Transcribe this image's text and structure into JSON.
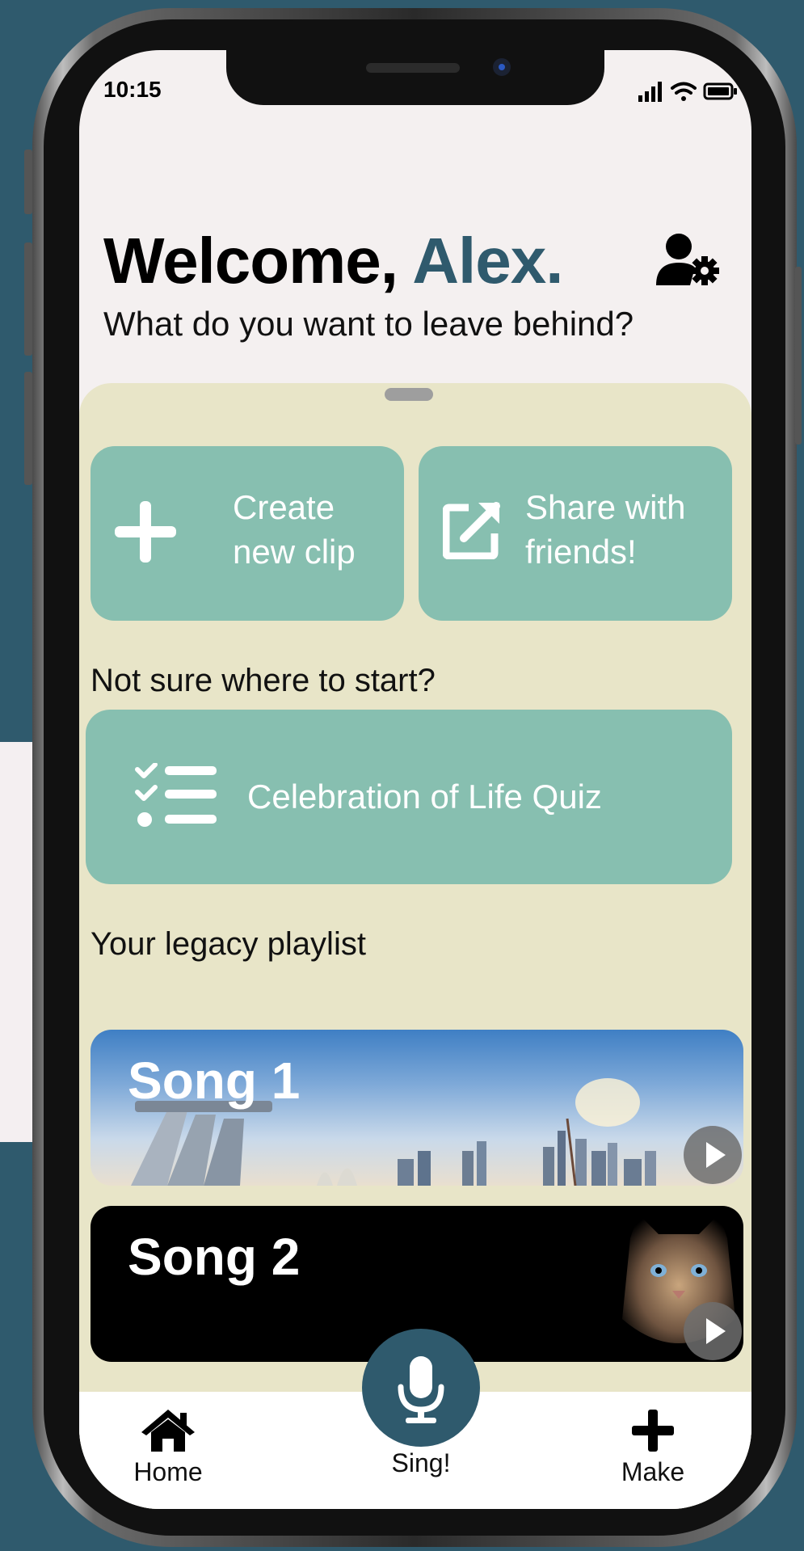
{
  "status_bar": {
    "time": "10:15"
  },
  "header": {
    "greeting": "Welcome,",
    "name": "Alex.",
    "subtitle": "What do you want to leave behind?"
  },
  "actions": {
    "create_line1": "Create",
    "create_line2": "new clip",
    "share_line1": "Share with",
    "share_line2": "friends!"
  },
  "quiz": {
    "prompt": "Not sure where to start?",
    "label": "Celebration of Life Quiz"
  },
  "playlist": {
    "heading": "Your legacy playlist",
    "songs": [
      {
        "title": "Song 1"
      },
      {
        "title": "Song 2"
      }
    ]
  },
  "tabbar": {
    "home": "Home",
    "sing": "Sing!",
    "make": "Make"
  },
  "colors": {
    "background": "#2f5a6d",
    "accent": "#2f5a6d",
    "card": "#87bfb0",
    "sheet": "#e8e5c8"
  },
  "icons": [
    "user-settings-icon",
    "plus-icon",
    "share-external-icon",
    "checklist-icon",
    "play-icon",
    "home-icon",
    "microphone-icon"
  ]
}
